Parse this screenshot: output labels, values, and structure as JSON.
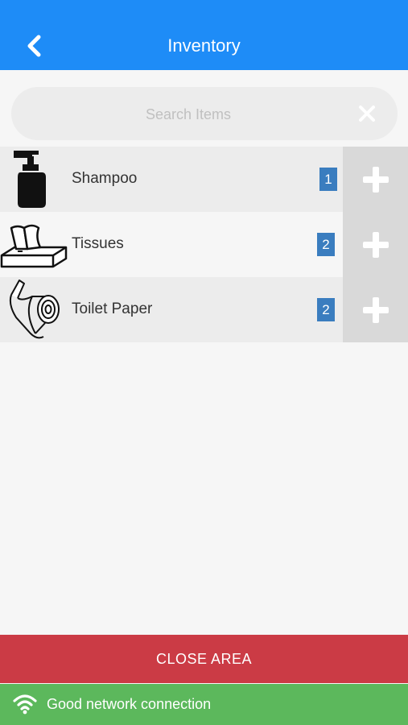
{
  "header": {
    "title": "Inventory",
    "back_icon": "chevron-left-icon"
  },
  "search": {
    "placeholder": "Search Items",
    "value": "",
    "clear_icon": "close-icon"
  },
  "items": [
    {
      "label": "Shampoo",
      "count": "1",
      "icon": "shampoo-bottle-icon",
      "action_icon": "plus-icon"
    },
    {
      "label": "Tissues",
      "count": "2",
      "icon": "tissue-box-icon",
      "action_icon": "plus-icon"
    },
    {
      "label": "Toilet Paper",
      "count": "2",
      "icon": "toilet-paper-icon",
      "action_icon": "plus-icon"
    }
  ],
  "footer": {
    "close_label": "CLOSE AREA",
    "network_status": "Good network connection",
    "network_icon": "wifi-icon"
  },
  "colors": {
    "header": "#1e8cf7",
    "badge": "#3a7dbf",
    "close": "#cb3b45",
    "network": "#5cb85c"
  }
}
